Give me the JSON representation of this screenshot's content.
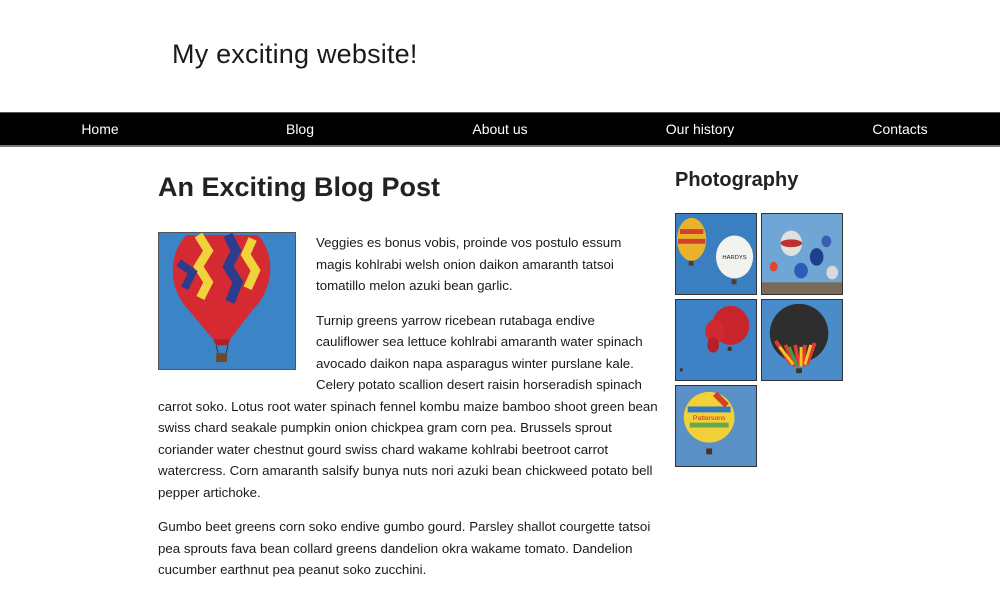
{
  "header": {
    "site_title": "My exciting website!"
  },
  "nav": {
    "items": [
      {
        "label": "Home"
      },
      {
        "label": "Blog"
      },
      {
        "label": "About us"
      },
      {
        "label": "Our history"
      },
      {
        "label": "Contacts"
      }
    ]
  },
  "main": {
    "post_title": "An Exciting Blog Post",
    "paragraphs": [
      "Veggies es bonus vobis, proinde vos postulo essum magis kohlrabi welsh onion daikon amaranth tatsoi tomatillo melon azuki bean garlic.",
      "Turnip greens yarrow ricebean rutabaga endive cauliflower sea lettuce kohlrabi amaranth water spinach avocado daikon napa asparagus winter purslane kale. Celery potato scallion desert raisin horseradish spinach carrot soko. Lotus root water spinach fennel kombu maize bamboo shoot green bean swiss chard seakale pumpkin onion chickpea gram corn pea. Brussels sprout coriander water chestnut gourd swiss chard wakame kohlrabi beetroot carrot watercress. Corn amaranth salsify bunya nuts nori azuki bean chickweed potato bell pepper artichoke.",
      "Gumbo beet greens corn soko endive gumbo gourd. Parsley shallot courgette tatsoi pea sprouts fava bean collard greens dandelion okra wakame tomato. Dandelion cucumber earthnut pea peanut soko zucchini."
    ]
  },
  "aside": {
    "title": "Photography",
    "photos": [
      {
        "label": "HARDYS"
      },
      {
        "label": ""
      },
      {
        "label": ""
      },
      {
        "label": ""
      },
      {
        "label": "Pattersons"
      }
    ]
  },
  "colors": {
    "sky": "#3f86c4",
    "nav_bg": "#000000"
  }
}
